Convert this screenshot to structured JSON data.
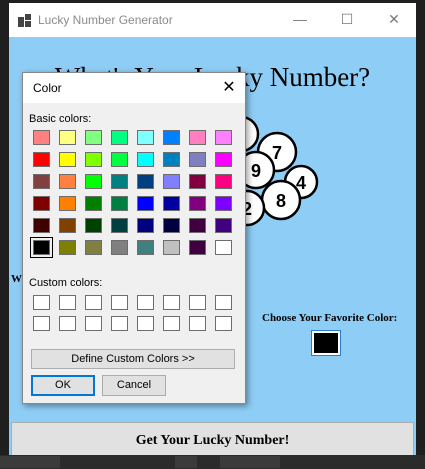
{
  "app": {
    "title": "Lucky Number Generator",
    "heading": "What's Your Lucky Number?",
    "left_label": "W",
    "color_label": "Choose Your Favorite Color:",
    "selected_color": "#000000",
    "generate_button": "Get Your Lucky Number!",
    "background_color": "#8ecdf5",
    "ball_numbers": [
      "7",
      "9",
      "2",
      "4",
      "8"
    ]
  },
  "window_controls": {
    "minimize": "—",
    "maximize": "☐",
    "close": "✕"
  },
  "dialog": {
    "title": "Color",
    "close": "✕",
    "basic_label": "Basic colors:",
    "custom_label": "Custom colors:",
    "define_button": "Define Custom Colors >>",
    "ok_button": "OK",
    "cancel_button": "Cancel",
    "basic_colors": [
      [
        "#ff8080",
        "#ffff80",
        "#80ff80",
        "#00ff80",
        "#80ffff",
        "#0080ff",
        "#ff80c0",
        "#ff80ff"
      ],
      [
        "#ff0000",
        "#ffff00",
        "#80ff00",
        "#00ff40",
        "#00ffff",
        "#0080c0",
        "#8080c0",
        "#ff00ff"
      ],
      [
        "#804040",
        "#ff8040",
        "#00ff00",
        "#008080",
        "#004080",
        "#8080ff",
        "#800040",
        "#ff0080"
      ],
      [
        "#800000",
        "#ff8000",
        "#008000",
        "#008040",
        "#0000ff",
        "#0000a0",
        "#800080",
        "#8000ff"
      ],
      [
        "#400000",
        "#804000",
        "#004000",
        "#004040",
        "#000080",
        "#000040",
        "#400040",
        "#400080"
      ],
      [
        "#000000",
        "#808000",
        "#808040",
        "#808080",
        "#408080",
        "#c0c0c0",
        "#400040",
        "#ffffff"
      ]
    ],
    "selected_index": [
      5,
      0
    ]
  }
}
